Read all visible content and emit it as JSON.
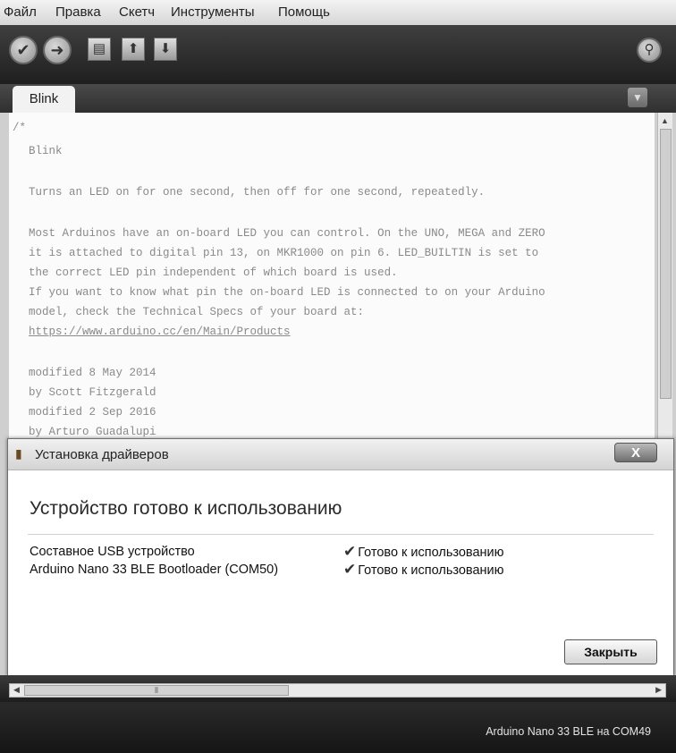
{
  "menubar": {
    "items": [
      "Файл",
      "Правка",
      "Скетч",
      "Инструменты",
      "Помощь"
    ]
  },
  "toolbar": {
    "buttons": [
      "checkmark-icon",
      "arrow-right-icon",
      "new-file-icon",
      "open-icon",
      "save-icon",
      "search-icon"
    ]
  },
  "tabs": [
    {
      "label": "Blink"
    }
  ],
  "editor": {
    "lines": [
      "/*",
      "Blink",
      "Turns an LED on for one second, then off for one second, repeatedly.",
      "Most Arduinos have an on-board LED you can control. On the UNO, MEGA and ZERO",
      "it is attached to digital pin 13, on MKR1000 on pin 6. LED_BUILTIN is set to",
      "the correct LED pin independent of which board is used.",
      "If you want to know what pin the on-board LED is connected to on your Arduino",
      "model, check the Technical Specs of your board at:",
      "https://www.arduino.cc/en/Main/Products",
      "modified 8 May 2014",
      "by Scott Fitzgerald",
      "modified 2 Sep 2016",
      "by Arturo Guadalupi"
    ]
  },
  "dialog": {
    "title": "Установка драйверов",
    "heading": "Устройство готово к использованию",
    "devices": [
      {
        "name": "Составное USB устройство",
        "status": "Готово к использованию"
      },
      {
        "name": "Arduino Nano 33 BLE Bootloader (COM50)",
        "status": "Готово к использованию"
      }
    ],
    "close_glyph": "X",
    "close_button": "Закрыть"
  },
  "statusbar": {
    "text": "Arduino Nano 33 BLE на COM49"
  }
}
